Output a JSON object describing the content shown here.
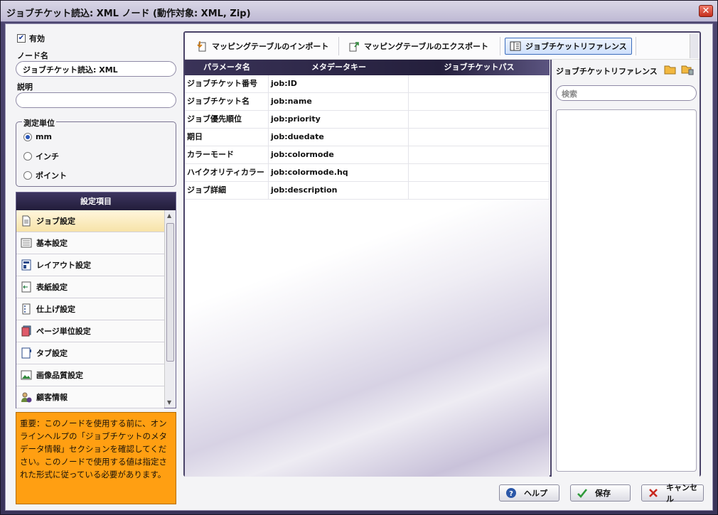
{
  "window": {
    "title": "ジョブチケット読込: XML ノード (動作対象: XML, Zip)",
    "close_glyph": "✕"
  },
  "enabled": {
    "label": "有効",
    "checked": true
  },
  "node_name": {
    "label": "ノード名",
    "value": "ジョブチケット読込: XML"
  },
  "description": {
    "label": "説明",
    "value": ""
  },
  "unit": {
    "label": "測定単位",
    "options": [
      "mm",
      "インチ",
      "ポイント"
    ],
    "selected": "mm"
  },
  "settings": {
    "header": "設定項目",
    "items": [
      {
        "label": "ジョブ設定",
        "icon": "document-icon",
        "selected": true
      },
      {
        "label": "基本設定",
        "icon": "list-icon"
      },
      {
        "label": "レイアウト設定",
        "icon": "layout-icon"
      },
      {
        "label": "表紙設定",
        "icon": "cover-icon"
      },
      {
        "label": "仕上げ設定",
        "icon": "finishing-icon"
      },
      {
        "label": "ページ単位設定",
        "icon": "page-icon"
      },
      {
        "label": "タブ設定",
        "icon": "tab-icon"
      },
      {
        "label": "画像品質設定",
        "icon": "image-icon"
      },
      {
        "label": "顧客情報",
        "icon": "customer-icon"
      }
    ]
  },
  "notice": "重要：このノードを使用する前に、オンラインヘルプの「ジョブチケットのメタデータ情報」セクションを確認してください。このノードで使用する値は指定された形式に従っている必要があります。",
  "toolbar": {
    "import_label": "マッピングテーブルのインポート",
    "export_label": "マッピングテーブルのエクスポート",
    "reference_label": "ジョブチケットリファレンス"
  },
  "table": {
    "headers": [
      "パラメータ名",
      "メタデータキー",
      "ジョブチケットパス"
    ],
    "rows": [
      [
        "ジョブチケット番号",
        "job:ID",
        ""
      ],
      [
        "ジョブチケット名",
        "job:name",
        ""
      ],
      [
        "ジョブ優先順位",
        "job:priority",
        ""
      ],
      [
        "期日",
        "job:duedate",
        ""
      ],
      [
        "カラーモード",
        "job:colormode",
        ""
      ],
      [
        "ハイクオリティカラー",
        "job:colormode.hq",
        ""
      ],
      [
        "ジョブ詳細",
        "job:description",
        ""
      ]
    ]
  },
  "reference": {
    "title": "ジョブチケットリファレンス",
    "search_placeholder": "検索"
  },
  "buttons": {
    "help": "ヘルプ",
    "save": "保存",
    "cancel": "キャンセル"
  },
  "colors": {
    "accent": "#3c6dbd",
    "notice_bg": "#ff9f12",
    "header_dark": "#241f3c"
  }
}
